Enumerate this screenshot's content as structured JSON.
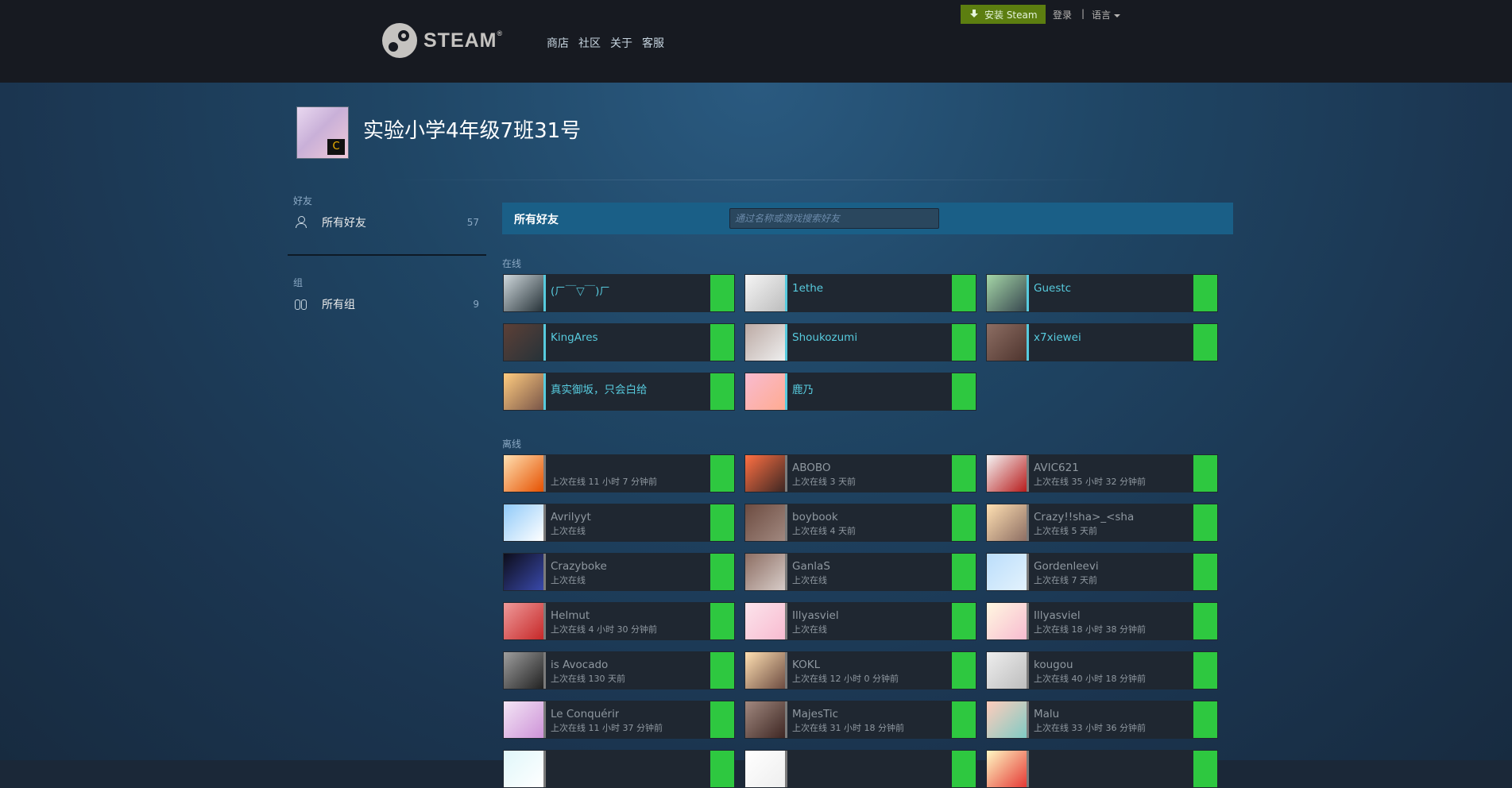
{
  "header": {
    "logo_text": "STEAM",
    "logo_mark": "®",
    "nav": [
      "商店",
      "社区",
      "关于",
      "客服"
    ],
    "install_label": "安装 Steam",
    "login_label": "登录",
    "separator": "|",
    "language_label": "语言"
  },
  "profile": {
    "name": "实验小学4年级7班31号",
    "badge_icon": "C"
  },
  "sidebar": {
    "friends_section": "好友",
    "friends_item": {
      "label": "所有好友",
      "count": "57"
    },
    "groups_section": "组",
    "groups_item": {
      "label": "所有组",
      "count": "9"
    }
  },
  "friends_panel": {
    "title": "所有好友",
    "search_placeholder": "通过名称或游戏搜索好友",
    "online_label": "在线",
    "offline_label": "离线"
  },
  "online": [
    {
      "name": "(ㄏ￣▽￣)ㄏ"
    },
    {
      "name": "1ethe"
    },
    {
      "name": "Guestc"
    },
    {
      "name": "KingAres"
    },
    {
      "name": "Shoukozumi"
    },
    {
      "name": "x7xiewei"
    },
    {
      "name": "真实御坂，只会白给"
    },
    {
      "name": "鹿乃"
    }
  ],
  "offline": [
    {
      "name": "",
      "status": "上次在线 11 小时 7 分钟前"
    },
    {
      "name": "ABOBO",
      "status": "上次在线 3 天前"
    },
    {
      "name": "AVIC621",
      "status": "上次在线 35 小时 32 分钟前"
    },
    {
      "name": "Avrilyyt",
      "status": "上次在线"
    },
    {
      "name": "boybook",
      "status": "上次在线 4 天前"
    },
    {
      "name": "Crazy!!sha>_<sha",
      "status": "上次在线 5 天前"
    },
    {
      "name": "Crazyboke",
      "status": "上次在线"
    },
    {
      "name": "GanlaS",
      "status": "上次在线"
    },
    {
      "name": "Gordenleevi",
      "status": "上次在线 7 天前"
    },
    {
      "name": "Helmut",
      "status": "上次在线 4 小时 30 分钟前"
    },
    {
      "name": "Illyasviel",
      "status": "上次在线"
    },
    {
      "name": "Illyasviel",
      "status": "上次在线 18 小时 38 分钟前"
    },
    {
      "name": "is Avocado",
      "status": "上次在线 130 天前"
    },
    {
      "name": "KOKL",
      "status": "上次在线 12 小时 0 分钟前"
    },
    {
      "name": "kougou",
      "status": "上次在线 40 小时 18 分钟前"
    },
    {
      "name": "Le Conquérir",
      "status": "上次在线 11 小时 37 分钟前"
    },
    {
      "name": "MajesTic",
      "status": "上次在线 31 小时 18 分钟前"
    },
    {
      "name": "Malu",
      "status": "上次在线 33 小时 36 分钟前"
    },
    {
      "name": "",
      "status": ""
    },
    {
      "name": "",
      "status": ""
    },
    {
      "name": "",
      "status": ""
    }
  ],
  "colors": {
    "online_name": "#57cbde",
    "offline_name": "#8f98a0",
    "status_green": "#2ec840",
    "header_bar": "#1a5f87",
    "install_button": "#5c7e10"
  }
}
